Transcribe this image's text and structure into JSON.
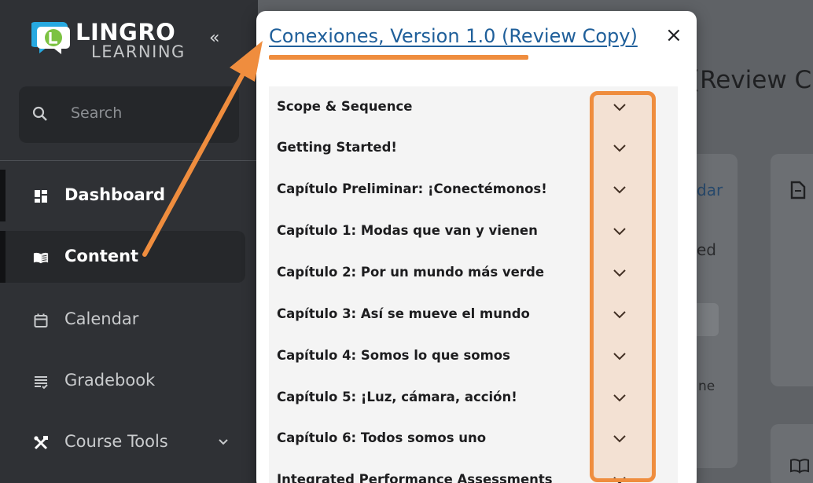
{
  "brand": {
    "line1": "LINGRO",
    "line2": "LEARNING",
    "accent": "#27a9e1"
  },
  "sidebar": {
    "collapse_label": "«",
    "search_placeholder": "Search",
    "items": [
      {
        "label": "Dashboard",
        "icon": "dashboard-icon"
      },
      {
        "label": "Content",
        "icon": "book-icon"
      },
      {
        "label": "Calendar",
        "icon": "calendar-icon"
      },
      {
        "label": "Gradebook",
        "icon": "gradebook-icon"
      },
      {
        "label": "Course Tools",
        "icon": "tools-icon"
      }
    ]
  },
  "background": {
    "title": "(Review C",
    "link_fragment": "dar",
    "text1": "ed",
    "text2": "ne"
  },
  "modal": {
    "title": "Conexiones, Version 1.0 (Review Copy)",
    "close_label": "×",
    "sections": [
      "Scope & Sequence",
      "Getting Started!",
      "Capítulo Preliminar: ¡Conectémonos!",
      "Capítulo 1: Modas que van y vienen",
      "Capítulo 2: Por un mundo más verde",
      "Capítulo 3: Así se mueve el mundo",
      "Capítulo 4: Somos lo que somos",
      "Capítulo 5: ¡Luz, cámara, acción!",
      "Capítulo 6: Todos somos uno",
      "Integrated Performance Assessments"
    ]
  },
  "colors": {
    "annotation": "#ef8d3e",
    "link": "#1f5f9a"
  }
}
